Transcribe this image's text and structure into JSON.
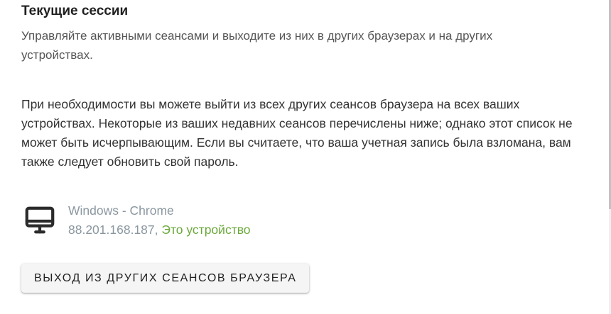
{
  "sessions_section": {
    "title": "Текущие сессии",
    "description": "Управляйте активными сеансами и выходите из них в других браузерах и на других устройствах.",
    "intro": "При необходимости вы можете выйти из всех других сеансов браузера на всех ваших устройствах. Некоторые из ваших недавних сеансов перечислены ниже; однако этот список не может быть исчерпывающим. Если вы считаете, что ваша учетная запись была взломана, вам также следует обновить свой пароль.",
    "sessions": [
      {
        "icon": "desktop-monitor-icon",
        "platform": "Windows - Chrome",
        "ip": "88.201.168.187,",
        "this_device_label": "Это устройство"
      }
    ],
    "logout_button_label": "Выход из других сеансов браузера"
  },
  "colors": {
    "title": "#212121",
    "muted": "#8a97a0",
    "this_device": "#6aa83a",
    "button_bg": "#f5f5f5"
  }
}
